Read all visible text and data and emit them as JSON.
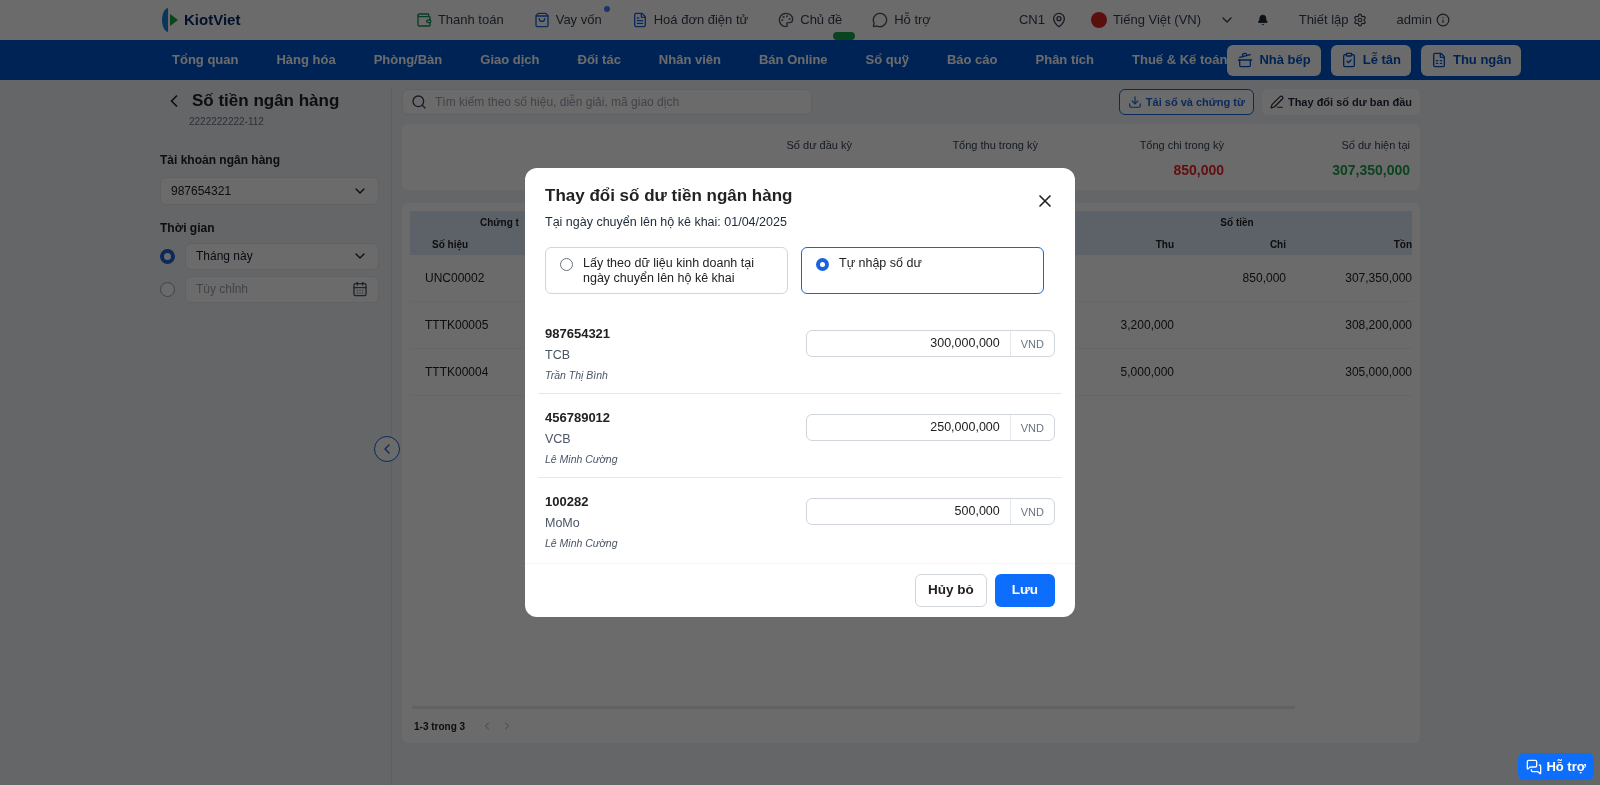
{
  "top_bar": {
    "logo": "KiotViet",
    "links": [
      {
        "label": "Thanh toán",
        "kind": "wallet",
        "dot": false,
        "badge": false
      },
      {
        "label": "Vay vốn",
        "kind": "bag",
        "dot": true,
        "badge": false
      },
      {
        "label": "Hoá đơn điện tử",
        "kind": "doc",
        "dot": false,
        "badge": false
      },
      {
        "label": "Chủ đề",
        "kind": "palette",
        "dot": false,
        "badge": true
      },
      {
        "label": "Hỗ trợ",
        "kind": "chat",
        "dot": false,
        "badge": false
      }
    ],
    "branch": "CN1",
    "language": "Tiếng Việt (VN)",
    "settings": "Thiết lập",
    "user": "admin"
  },
  "nav": {
    "items": [
      "Tổng quan",
      "Hàng hóa",
      "Phòng/Bàn",
      "Giao dịch",
      "Đối tác",
      "Nhân viên",
      "Bán Online",
      "Sổ quỹ",
      "Báo cáo",
      "Phân tích",
      "Thuế & Kế toán"
    ],
    "buttons": [
      {
        "label": "Nhà bếp",
        "kind": "kitchen"
      },
      {
        "label": "Lễ tân",
        "kind": "reception"
      },
      {
        "label": "Thu ngân",
        "kind": "cashier"
      }
    ]
  },
  "page": {
    "title": "Số tiền ngân hàng",
    "subtitle": "2222222222-112",
    "search_placeholder": "Tìm kiếm theo số hiệu, diễn giải, mã giao dịch",
    "actions": [
      {
        "label": "Tải sổ và chứng từ",
        "kind": "download"
      },
      {
        "label": "Thay đổi số dư ban đầu",
        "kind": "edit"
      }
    ]
  },
  "filters": {
    "account_label": "Tài khoản ngân hàng",
    "account_value": "987654321",
    "time_label": "Thời gian",
    "time_options": [
      {
        "kind": "select",
        "value": "Tháng này",
        "selected": true
      },
      {
        "kind": "date",
        "placeholder": "Tùy chỉnh",
        "selected": false
      }
    ]
  },
  "summary": [
    {
      "label": "Số dư đầu kỳ"
    },
    {
      "label": "Tổng thu trong kỳ"
    },
    {
      "label": "Tổng chi trong kỳ",
      "value": "850,000",
      "kind": "negative"
    },
    {
      "label": "Số dư hiện tại",
      "value": "307,350,000",
      "kind": "positive"
    }
  ],
  "table": {
    "groups": [
      "Chứng t",
      "Số tiền"
    ],
    "columns": [
      "Số hiệu",
      "Thu",
      "Chi",
      "Tồn"
    ],
    "rows": [
      [
        "UNC00002",
        "",
        "850,000",
        "307,350,000"
      ],
      [
        "TTTK00005",
        "3,200,000",
        "",
        "308,200,000"
      ],
      [
        "TTTK00004",
        "5,000,000",
        "",
        "305,000,000"
      ]
    ]
  },
  "pagination": "1-3 trong 3",
  "modal": {
    "title": "Thay đổi số dư tiền ngân hàng",
    "subtitle": "Tại ngày chuyển lên hộ kê khai: 01/04/2025",
    "options": [
      {
        "label": "Lấy theo dữ liệu kinh doanh tại ngày chuyển lên hộ kê khai",
        "selected": false
      },
      {
        "label": "Tự nhập số dư",
        "selected": true
      }
    ],
    "accounts": [
      {
        "number": "987654321",
        "bank": "TCB",
        "holder": "Trần Thị Bình",
        "value": "300,000,000",
        "unit": "VND"
      },
      {
        "number": "456789012",
        "bank": "VCB",
        "holder": "Lê Minh Cường",
        "value": "250,000,000",
        "unit": "VND"
      },
      {
        "number": "100282",
        "bank": "MoMo",
        "holder": "Lê Minh Cường",
        "value": "500,000",
        "unit": "VND"
      }
    ],
    "buttons": [
      {
        "label": "Hủy bỏ",
        "kind": "secondary"
      },
      {
        "label": "Lưu",
        "kind": "primary"
      }
    ]
  },
  "help_button": "Hỗ trợ"
}
